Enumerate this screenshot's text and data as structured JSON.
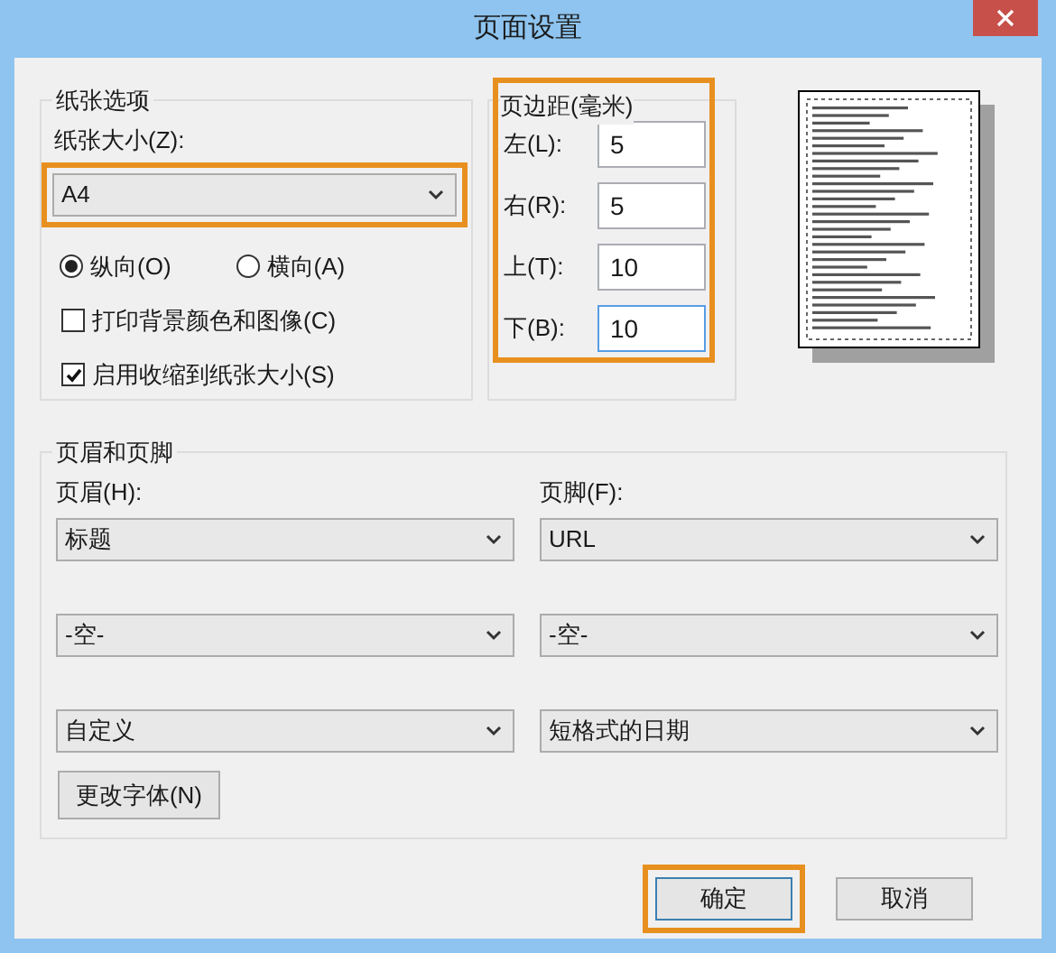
{
  "window": {
    "title": "页面设置"
  },
  "paper": {
    "legend": "纸张选项",
    "size_label": "纸张大小(Z):",
    "size": {
      "value": "A4",
      "highlighted": true
    },
    "orientations": [
      {
        "label": "纵向(O)",
        "selected": true
      },
      {
        "label": "横向(A)",
        "selected": false
      }
    ],
    "options": [
      {
        "label": "打印背景颜色和图像(C)",
        "checked": false
      },
      {
        "label": "启用收缩到纸张大小(S)",
        "checked": true
      }
    ]
  },
  "margins": {
    "legend": "页边距(毫米)",
    "highlighted": true,
    "fields": [
      {
        "label": "左(L):",
        "value": "5",
        "focused": false
      },
      {
        "label": "右(R):",
        "value": "5",
        "focused": false
      },
      {
        "label": "上(T):",
        "value": "10",
        "focused": false
      },
      {
        "label": "下(B):",
        "value": "10",
        "focused": true
      }
    ]
  },
  "header_footer": {
    "legend": "页眉和页脚",
    "header_label": "页眉(H):",
    "footer_label": "页脚(F):",
    "header": [
      "标题",
      "-空-",
      "自定义"
    ],
    "footer": [
      "URL",
      "-空-",
      "短格式的日期"
    ],
    "font_button": "更改字体(N)"
  },
  "buttons": [
    {
      "label": "确定",
      "highlighted": true
    },
    {
      "label": "取消",
      "highlighted": false
    }
  ]
}
